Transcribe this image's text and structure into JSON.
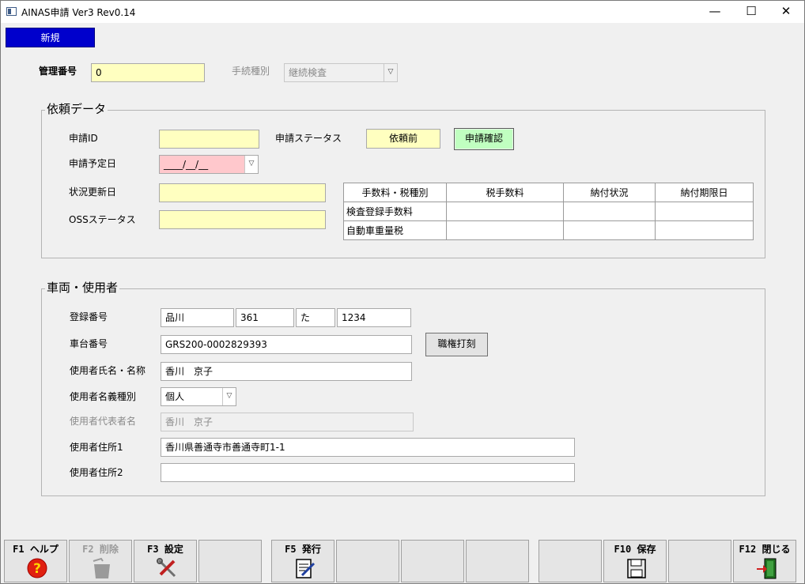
{
  "window": {
    "title": "AINAS申請 Ver3 Rev0.14",
    "minimize": "—",
    "maximize": "☐",
    "close": "✕"
  },
  "mode_tab": "新規",
  "header": {
    "kanri_label": "管理番号",
    "kanri_value": "0",
    "tetsuzuki_label": "手続種別",
    "tetsuzuki_value": "継続検査"
  },
  "request": {
    "group_title": "依頼データ",
    "shinsei_id_label": "申請ID",
    "shinsei_id_value": "",
    "status_label": "申請ステータス",
    "status_value": "依頼前",
    "confirm_button": "申請確認",
    "yotei_label": "申請予定日",
    "yotei_value": "____/__/__",
    "koshin_label": "状況更新日",
    "koshin_value": "",
    "oss_label": "OSSステータス",
    "oss_value": "",
    "fee_table": {
      "headers": [
        "手数料・税種別",
        "税手数料",
        "納付状況",
        "納付期限日"
      ],
      "rows": [
        [
          "検査登録手数料",
          "",
          "",
          ""
        ],
        [
          "自動車重量税",
          "",
          "",
          ""
        ]
      ]
    }
  },
  "vehicle": {
    "group_title": "車両・使用者",
    "toroku_label": "登録番号",
    "toroku_parts": [
      "品川",
      "361",
      "た",
      "1234"
    ],
    "shadai_label": "車台番号",
    "shadai_value": "GRS200-0002829393",
    "shokken_button": "職権打刻",
    "shimei_label": "使用者氏名・名称",
    "shimei_value": "香川　京子",
    "meigi_label": "使用者名義種別",
    "meigi_value": "個人",
    "daihyo_label": "使用者代表者名",
    "daihyo_value": "香川　京子",
    "jusho1_label": "使用者住所1",
    "jusho1_value": "香川県善通寺市善通寺町1-1",
    "jusho2_label": "使用者住所2",
    "jusho2_value": ""
  },
  "fkeys": {
    "f1": "F1 ヘルプ",
    "f2": "F2 削除",
    "f3": "F3 設定",
    "f5": "F5 発行",
    "f10": "F10 保存",
    "f12": "F12 閉じる"
  }
}
